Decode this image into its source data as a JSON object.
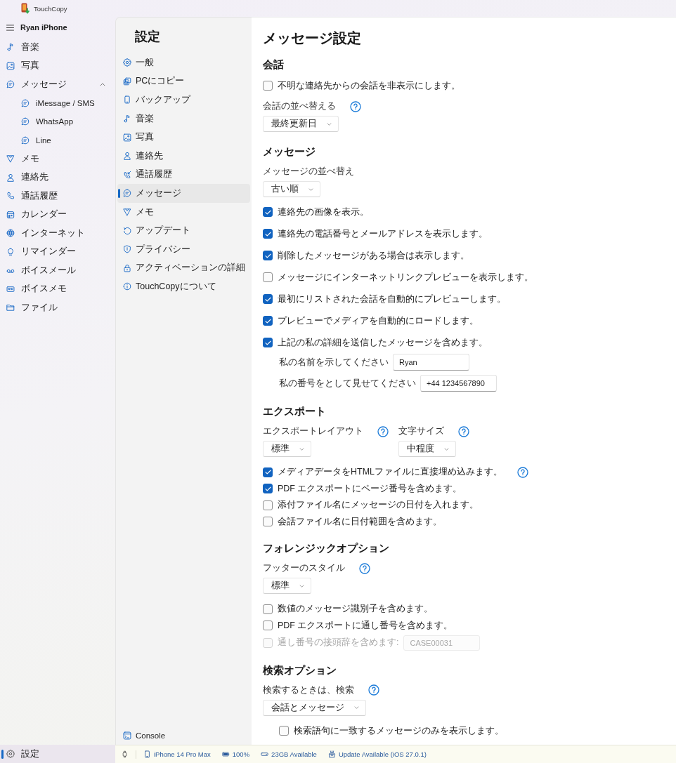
{
  "app": {
    "name": "TouchCopy"
  },
  "sidebar": {
    "device": "Ryan iPhone",
    "items": [
      {
        "label": "音楽",
        "selected": false
      },
      {
        "label": "写真",
        "selected": false
      },
      {
        "label": "メッセージ",
        "selected": false,
        "expanded": true,
        "children": [
          {
            "label": "iMessage / SMS",
            "selected": false
          },
          {
            "label": "WhatsApp",
            "selected": false
          },
          {
            "label": "Line",
            "selected": false
          }
        ]
      },
      {
        "label": "メモ",
        "selected": false
      },
      {
        "label": "連絡先",
        "selected": false
      },
      {
        "label": "通話履歴",
        "selected": false
      },
      {
        "label": "カレンダー",
        "selected": false
      },
      {
        "label": "インターネット",
        "selected": false
      },
      {
        "label": "リマインダー",
        "selected": false
      },
      {
        "label": "ボイスメール",
        "selected": false
      },
      {
        "label": "ボイスメモ",
        "selected": false
      },
      {
        "label": "ファイル",
        "selected": false
      }
    ],
    "footer": {
      "label": "設定",
      "selected": true
    }
  },
  "settings_nav": {
    "title": "設定",
    "items": [
      {
        "label": "一般",
        "selected": false
      },
      {
        "label": "PCにコピー",
        "selected": false
      },
      {
        "label": "バックアップ",
        "selected": false
      },
      {
        "label": "音楽",
        "selected": false
      },
      {
        "label": "写真",
        "selected": false
      },
      {
        "label": "連絡先",
        "selected": false
      },
      {
        "label": "通話履歴",
        "selected": false
      },
      {
        "label": "メッセージ",
        "selected": true
      },
      {
        "label": "メモ",
        "selected": false
      },
      {
        "label": "アップデート",
        "selected": false
      },
      {
        "label": "プライバシー",
        "selected": false
      },
      {
        "label": "アクティベーションの詳細",
        "selected": false
      },
      {
        "label": "TouchCopyについて",
        "selected": false
      }
    ],
    "console": {
      "label": "Console"
    }
  },
  "page": {
    "title": "メッセージ設定",
    "sections": [
      {
        "heading": "会話",
        "controls": [
          {
            "kind": "checkbox",
            "label": "不明な連絡先からの会話を非表示にします。",
            "checked": false,
            "disabled": false
          },
          {
            "kind": "selects",
            "items": [
              {
                "label": "会話の並べ替える",
                "help": true,
                "value": "最終更新日"
              }
            ]
          }
        ]
      },
      {
        "heading": "メッセージ",
        "controls": [
          {
            "kind": "selects",
            "items": [
              {
                "label": "メッセージの並べ替え",
                "value": "古い順"
              }
            ]
          },
          {
            "kind": "checkbox",
            "label": "連絡先の画像を表示。",
            "checked": true,
            "disabled": false
          },
          {
            "kind": "checkbox",
            "label": "連絡先の電話番号とメールアドレスを表示します。",
            "checked": true,
            "disabled": false
          },
          {
            "kind": "checkbox",
            "label": "削除したメッセージがある場合は表示します。",
            "checked": true,
            "disabled": false
          },
          {
            "kind": "checkbox",
            "label": "メッセージにインターネットリンクプレビューを表示します。",
            "checked": false,
            "disabled": false
          },
          {
            "kind": "checkbox",
            "label": "最初にリストされた会話を自動的にプレビューします。",
            "checked": true,
            "disabled": false
          },
          {
            "kind": "checkbox",
            "label": "プレビューでメディアを自動的にロードします。",
            "checked": true,
            "disabled": false
          },
          {
            "kind": "checkbox",
            "label": "上記の私の詳細を送信したメッセージを含めます。",
            "checked": true,
            "disabled": false,
            "children": [
              {
                "kind": "field",
                "label": "私の名前を示してください",
                "value": "Ryan"
              },
              {
                "kind": "field",
                "label": "私の番号をとして見せてください",
                "value": "+44 1234567890"
              }
            ]
          }
        ]
      },
      {
        "heading": "エクスポート",
        "controls": [
          {
            "kind": "selects",
            "items": [
              {
                "label": "エクスポートレイアウト",
                "help": true,
                "value": "標準"
              },
              {
                "label": "文字サイズ",
                "help": true,
                "value": "中程度"
              }
            ]
          },
          {
            "kind": "checkbox",
            "label": "メディアデータをHTMLファイルに直接埋め込みます。",
            "checked": true,
            "disabled": false,
            "help": true
          },
          {
            "kind": "checkbox",
            "label": "PDF エクスポートにページ番号を含めます。",
            "checked": true,
            "disabled": false
          },
          {
            "kind": "checkbox",
            "label": "添付ファイル名にメッセージの日付を入れます。",
            "checked": false,
            "disabled": false
          },
          {
            "kind": "checkbox",
            "label": "会話ファイル名に日付範囲を含めます。",
            "checked": false,
            "disabled": false
          }
        ]
      },
      {
        "heading": "フォレンジックオプション",
        "controls": [
          {
            "kind": "selects",
            "items": [
              {
                "label": "フッターのスタイル",
                "help": true,
                "value": "標準"
              }
            ]
          },
          {
            "kind": "checkbox",
            "label": "数値のメッセージ識別子を含めます。",
            "checked": false,
            "disabled": false
          },
          {
            "kind": "checkbox",
            "label": "PDF エクスポートに通し番号を含めます。",
            "checked": false,
            "disabled": false
          },
          {
            "kind": "checkbox",
            "label": "通し番号の接頭辞を含めます:",
            "checked": false,
            "disabled": true,
            "field": {
              "value": "CASE00031"
            }
          }
        ]
      },
      {
        "heading": "検索オプション",
        "controls": [
          {
            "kind": "selects",
            "items": [
              {
                "label": "検索するときは、検索",
                "help": true,
                "value": "会話とメッセージ"
              }
            ],
            "children": [
              {
                "kind": "checkbox",
                "label": "検索語句に一致するメッセージのみを表示します。",
                "checked": false,
                "disabled": false
              }
            ]
          }
        ]
      }
    ]
  },
  "status_bar": {
    "items": [
      "iPhone 14 Pro Max",
      "100%",
      "23GB Available",
      "Update Available (iOS 27.0.1)"
    ]
  }
}
